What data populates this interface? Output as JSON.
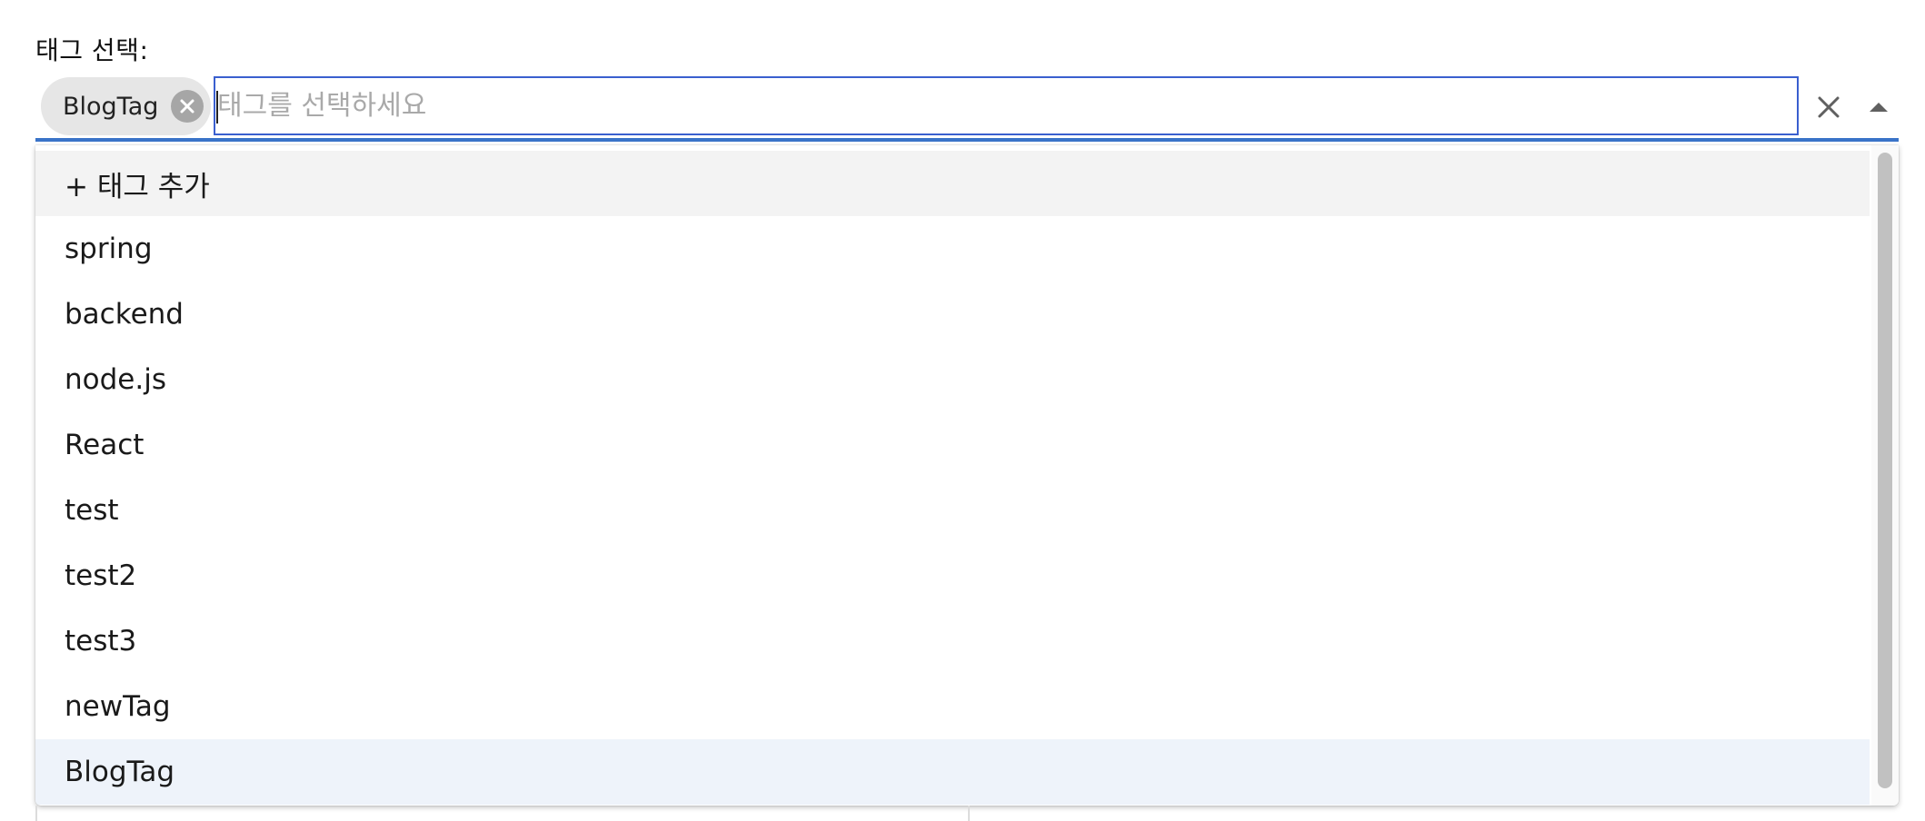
{
  "label": "태그 선택:",
  "selected_chips": [
    {
      "label": "BlogTag"
    }
  ],
  "input": {
    "value": "",
    "placeholder": "태그를 선택하세요"
  },
  "icons": {
    "chip_delete": "cancel-circle-icon",
    "clear": "close-icon",
    "toggle": "arrow-drop-up-icon"
  },
  "menu": {
    "add_option": "+ 태그 추가",
    "options": [
      "spring",
      "backend",
      "node.js",
      "React",
      "test",
      "test2",
      "test3",
      "newTag",
      "BlogTag"
    ],
    "selected": "BlogTag"
  },
  "colors": {
    "accent": "#3a73c8",
    "input_border": "#3a5fcf",
    "chip_bg": "#e6e6e6",
    "selected_bg": "#eef3fa",
    "add_bg": "#f3f3f3"
  }
}
